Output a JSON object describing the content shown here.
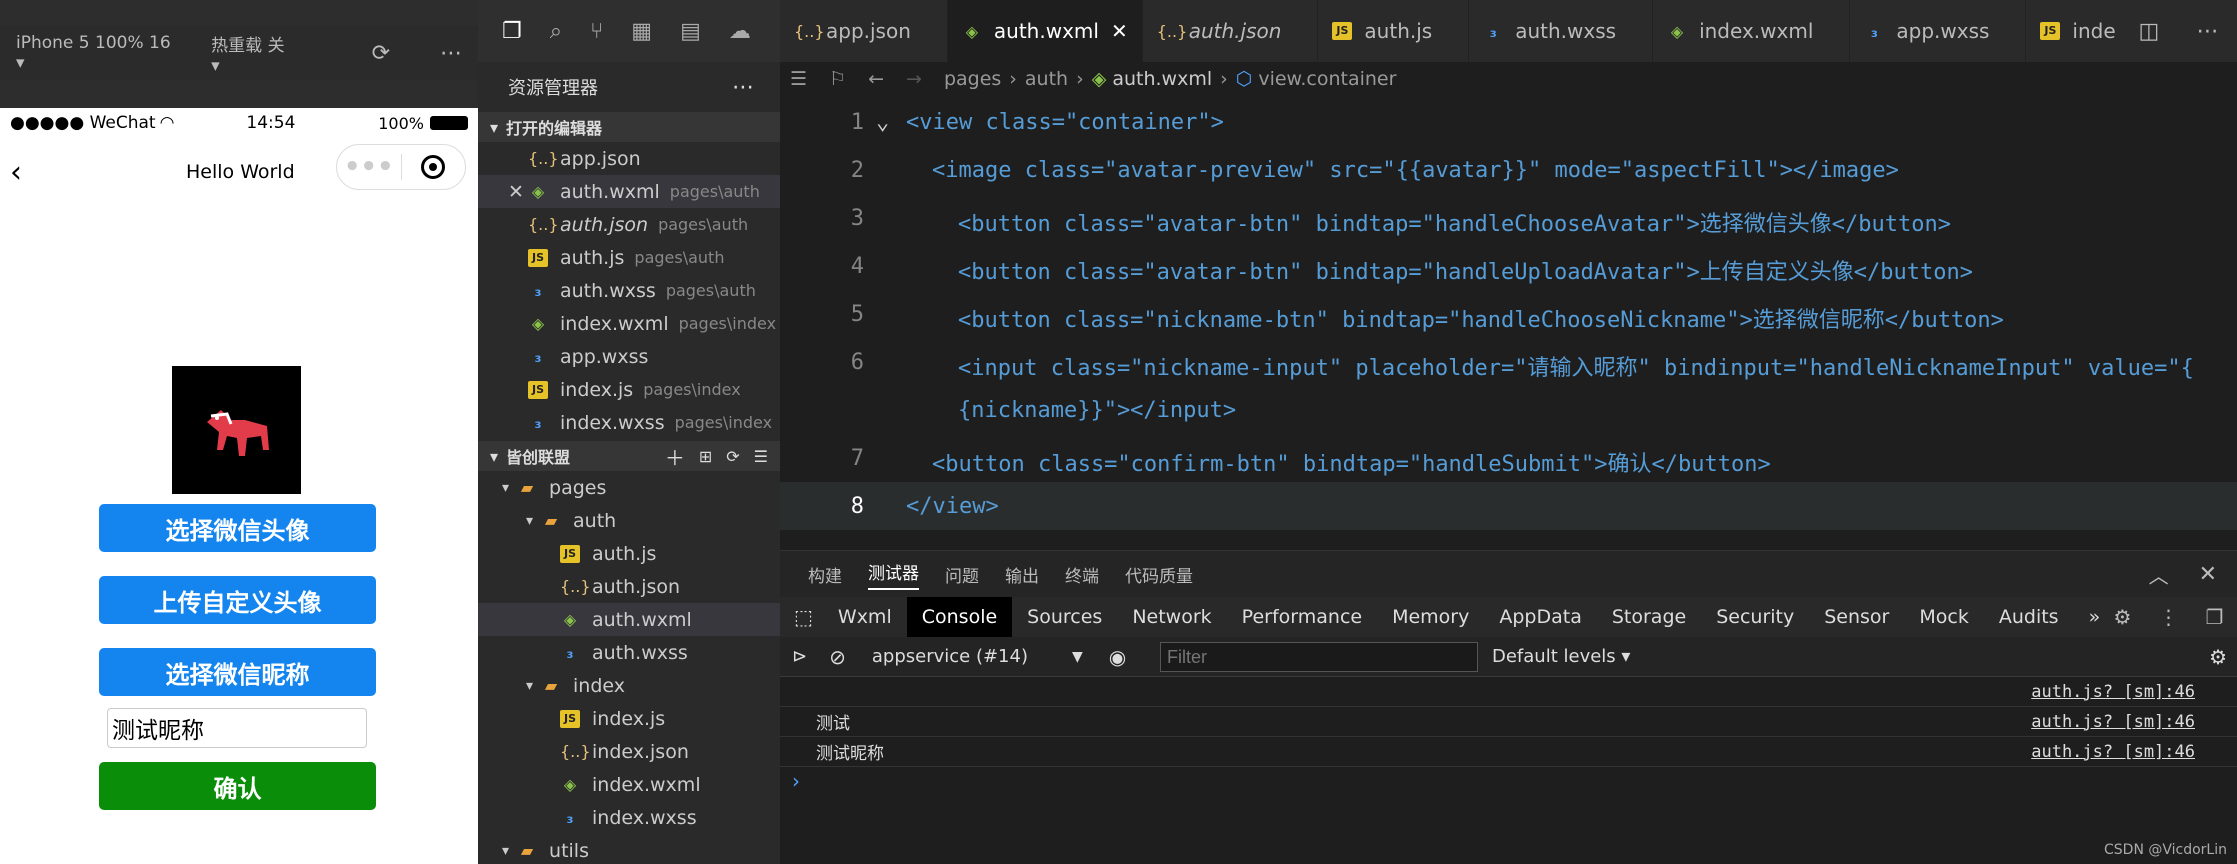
{
  "simulator": {
    "device": "iPhone 5 100% 16 ▾",
    "hot_reload": "热重载 关 ▾",
    "status": {
      "carrier": "●●●●● WeChat",
      "time": "14:54",
      "battery": "100%"
    },
    "nav_title": "Hello World",
    "buttons": {
      "choose_avatar": "选择微信头像",
      "upload_avatar": "上传自定义头像",
      "choose_nickname": "选择微信昵称",
      "confirm": "确认"
    },
    "nickname_value": "测试昵称"
  },
  "explorer": {
    "title": "资源管理器",
    "open_editors_title": "打开的编辑器",
    "open_editors": [
      {
        "name": "app.json",
        "path": "",
        "type": "json"
      },
      {
        "name": "auth.wxml",
        "path": "pages\\auth",
        "type": "wxml"
      },
      {
        "name": "auth.json",
        "path": "pages\\auth",
        "type": "json"
      },
      {
        "name": "auth.js",
        "path": "pages\\auth",
        "type": "js"
      },
      {
        "name": "auth.wxss",
        "path": "pages\\auth",
        "type": "wxss"
      },
      {
        "name": "index.wxml",
        "path": "pages\\index",
        "type": "wxml"
      },
      {
        "name": "app.wxss",
        "path": "",
        "type": "wxss"
      },
      {
        "name": "index.js",
        "path": "pages\\index",
        "type": "js"
      },
      {
        "name": "index.wxss",
        "path": "pages\\index",
        "type": "wxss"
      }
    ],
    "project_title": "皆创联盟",
    "tree": [
      {
        "name": "pages",
        "type": "folder",
        "depth": 1
      },
      {
        "name": "auth",
        "type": "folder",
        "depth": 2
      },
      {
        "name": "auth.js",
        "type": "js",
        "depth": 3
      },
      {
        "name": "auth.json",
        "type": "json",
        "depth": 3
      },
      {
        "name": "auth.wxml",
        "type": "wxml",
        "depth": 3
      },
      {
        "name": "auth.wxss",
        "type": "wxss",
        "depth": 3
      },
      {
        "name": "index",
        "type": "folder",
        "depth": 2
      },
      {
        "name": "index.js",
        "type": "js",
        "depth": 3
      },
      {
        "name": "index.json",
        "type": "json",
        "depth": 3
      },
      {
        "name": "index.wxml",
        "type": "wxml",
        "depth": 3
      },
      {
        "name": "index.wxss",
        "type": "wxss",
        "depth": 3
      },
      {
        "name": "utils",
        "type": "folder",
        "depth": 1
      }
    ]
  },
  "editor": {
    "tabs": [
      {
        "name": "app.json",
        "type": "json"
      },
      {
        "name": "auth.wxml",
        "type": "wxml"
      },
      {
        "name": "auth.json",
        "type": "json"
      },
      {
        "name": "auth.js",
        "type": "js"
      },
      {
        "name": "auth.wxss",
        "type": "wxss"
      },
      {
        "name": "index.wxml",
        "type": "wxml"
      },
      {
        "name": "app.wxss",
        "type": "wxss"
      },
      {
        "name": "inde",
        "type": "js"
      }
    ],
    "breadcrumb": {
      "pages": "pages",
      "auth": "auth",
      "file": "auth.wxml",
      "node": "view.container"
    },
    "line_numbers": [
      "1",
      "2",
      "3",
      "4",
      "5",
      "6",
      "7",
      "8"
    ],
    "lines": [
      "<view class=\"container\">",
      "<image class=\"avatar-preview\" src=\"{{avatar}}\" mode=\"aspectFill\"></image>",
      "<button class=\"avatar-btn\" bindtap=\"handleChooseAvatar\">选择微信头像</button>",
      "<button class=\"avatar-btn\" bindtap=\"handleUploadAvatar\">上传自定义头像</button>",
      "<button class=\"nickname-btn\" bindtap=\"handleChooseNickname\">选择微信昵称</button>",
      "<input class=\"nickname-input\" placeholder=\"请输入昵称\" bindinput=\"handleNicknameInput\" value=\"{",
      "{nickname}}\"></input>",
      "<button class=\"confirm-btn\" bindtap=\"handleSubmit\">确认</button>",
      "</view>"
    ]
  },
  "panel": {
    "tabs": [
      "构建",
      "测试器",
      "问题",
      "输出",
      "终端",
      "代码质量"
    ],
    "devtools_tabs": [
      "Wxml",
      "Console",
      "Sources",
      "Network",
      "Performance",
      "Memory",
      "AppData",
      "Storage",
      "Security",
      "Sensor",
      "Mock",
      "Audits",
      "»"
    ],
    "context": "appservice (#14)",
    "filter_placeholder": "Filter",
    "levels": "Default levels ▾",
    "logs": [
      {
        "text": "",
        "source": "auth.js? [sm]:46"
      },
      {
        "text": "测试",
        "source": "auth.js? [sm]:46"
      },
      {
        "text": "测试昵称",
        "source": "auth.js? [sm]:46"
      }
    ],
    "prompt": "›"
  },
  "watermark": "CSDN @VicdorLin"
}
